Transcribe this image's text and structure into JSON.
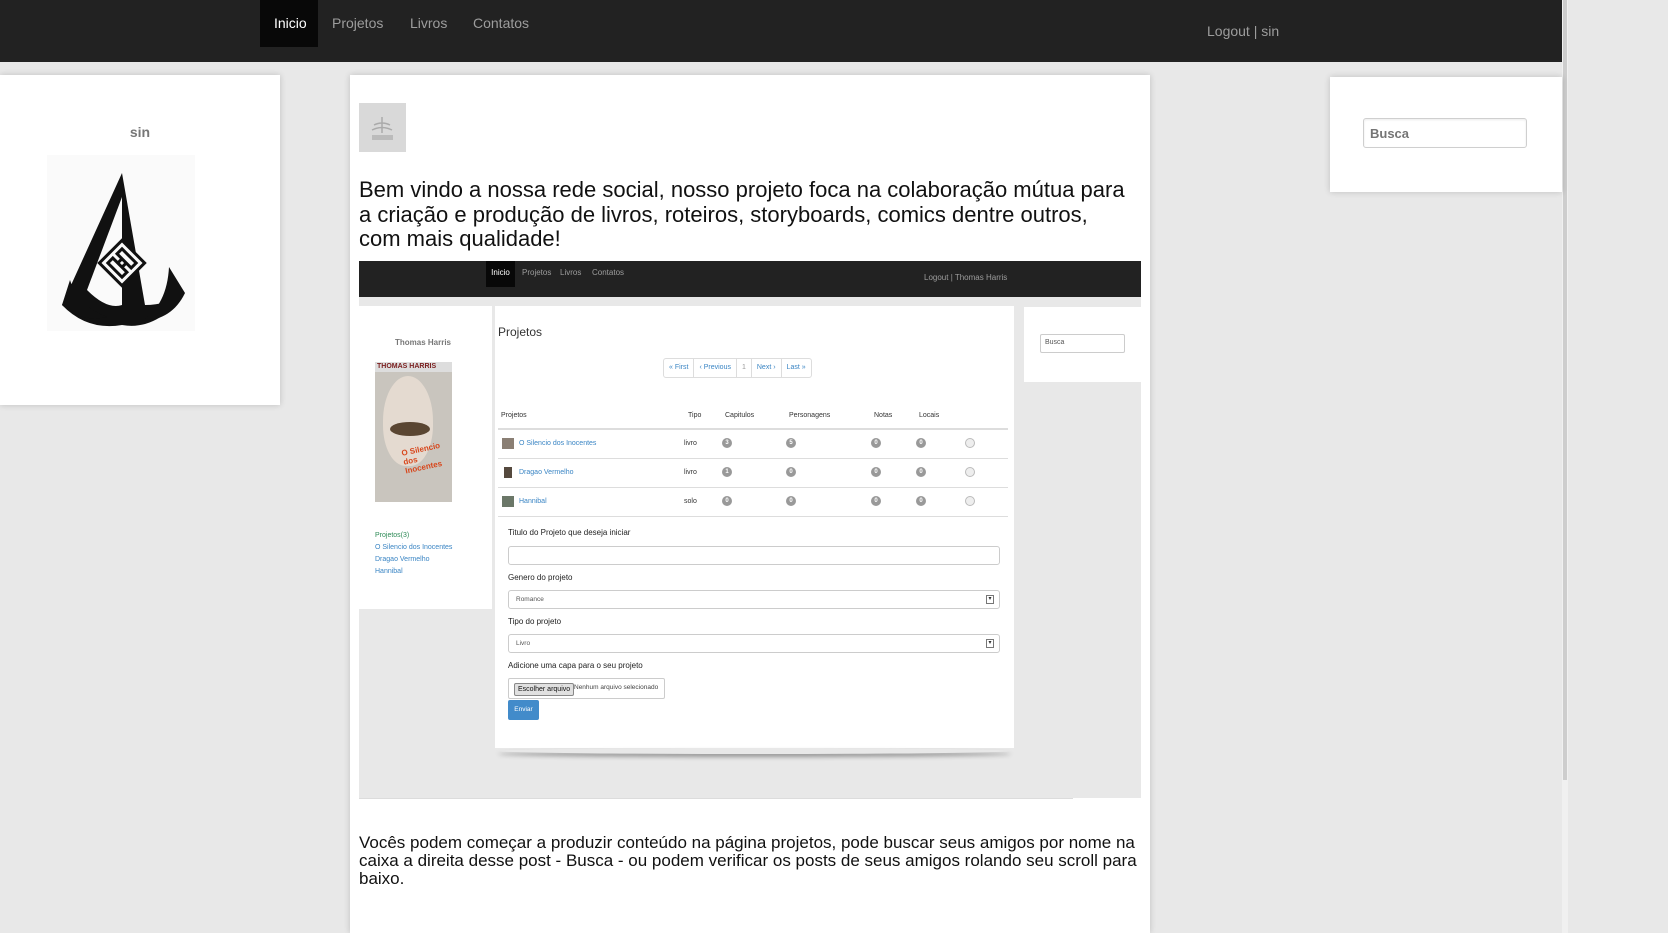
{
  "nav": {
    "items": [
      {
        "label": "Inicio",
        "active": true
      },
      {
        "label": "Projetos",
        "active": false
      },
      {
        "label": "Livros",
        "active": false
      },
      {
        "label": "Contatos",
        "active": false
      }
    ],
    "logout": "Logout | sin"
  },
  "profile": {
    "name": "sin"
  },
  "search": {
    "placeholder": "Busca"
  },
  "post": {
    "welcome": "Bem vindo a nossa rede social, nosso projeto foca na colaboração mútua para a criação e produção de livros, roteiros, storyboards, comics dentre outros, com mais qualidade!",
    "footer_text": "Vocês podem começar a produzir conteúdo na página projetos, pode buscar seus amigos por nome na caixa a direita desse post - Busca - ou podem verificar os posts de seus amigos rolando seu scroll para baixo."
  },
  "embedded": {
    "nav": [
      "Inicio",
      "Projetos",
      "Livros",
      "Contatos"
    ],
    "logout": "Logout | Thomas Harris",
    "profile_name": "Thomas Harris",
    "book_cover": {
      "author": "THOMAS HARRIS",
      "title": "O Silencio dos Inocentes"
    },
    "sidebar_links": [
      "Projetos(3)",
      "O Silencio dos Inocentes",
      "Dragao Vermelho",
      "Hannibal"
    ],
    "page_title": "Projetos",
    "pager": [
      "« First",
      "‹ Previous",
      "1",
      "Next ›",
      "Last »"
    ],
    "table": {
      "headers": [
        "Projetos",
        "Tipo",
        "Capitulos",
        "Personagens",
        "Notas",
        "Locais"
      ],
      "rows": [
        {
          "name": "O Silencio dos Inocentes",
          "tipo": "livro",
          "capitulos": "3",
          "personagens": "5",
          "notas": "0",
          "locais": "0"
        },
        {
          "name": "Dragao Vermelho",
          "tipo": "livro",
          "capitulos": "1",
          "personagens": "0",
          "notas": "0",
          "locais": "0"
        },
        {
          "name": "Hannibal",
          "tipo": "solo",
          "capitulos": "0",
          "personagens": "0",
          "notas": "0",
          "locais": "0"
        }
      ]
    },
    "form": {
      "title_label": "Titulo do Projeto que deseja iniciar",
      "genre_label": "Genero do projeto",
      "genre_value": "Romance",
      "type_label": "Tipo do projeto",
      "type_value": "Livro",
      "cover_label": "Adicione uma capa para o seu projeto",
      "file_button": "Escolher arquivo",
      "file_status": "Nenhum arquivo selecionado",
      "submit": "Enviar"
    },
    "search_placeholder": "Busca"
  }
}
